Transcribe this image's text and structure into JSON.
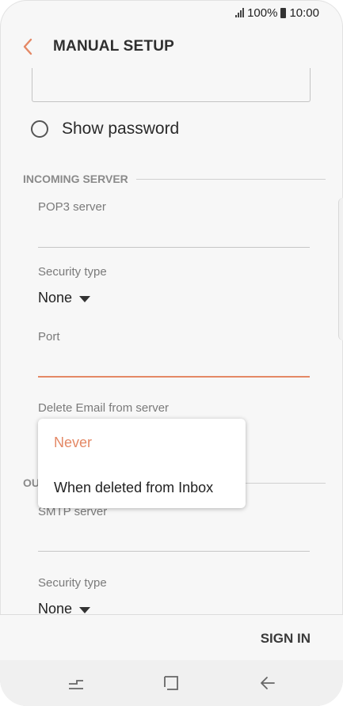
{
  "status_bar": {
    "battery": "100%",
    "time": "10:00"
  },
  "header": {
    "title": "MANUAL SETUP"
  },
  "show_password": {
    "label": "Show password",
    "checked": false
  },
  "incoming": {
    "section_title": "INCOMING SERVER",
    "pop3_label": "POP3 server",
    "security_label": "Security type",
    "security_value": "None",
    "port_label": "Port",
    "delete_label": "Delete Email from server"
  },
  "delete_dropdown": {
    "options": [
      "Never",
      "When deleted from Inbox"
    ],
    "selected": "Never"
  },
  "outgoing": {
    "section_title_visible": "OU",
    "smtp_label": "SMTP server",
    "security_label": "Security type",
    "security_value": "None"
  },
  "footer": {
    "sign_in_label": "SIGN IN"
  },
  "colors": {
    "accent": "#e48865",
    "background": "#f7f7f7",
    "text": "#222222"
  },
  "icons": {
    "back": "chevron-left-icon",
    "signal": "signal-icon",
    "battery": "battery-icon",
    "recents": "recents-icon",
    "home": "home-icon",
    "nav_back": "back-arrow-icon"
  }
}
